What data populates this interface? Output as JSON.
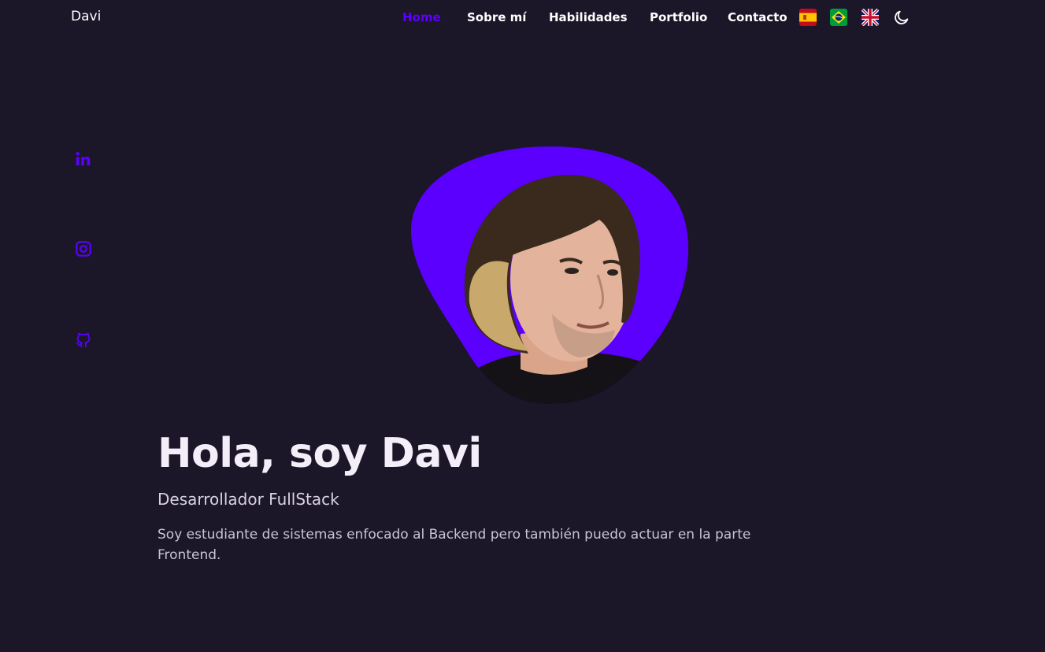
{
  "header": {
    "logo": "Davi",
    "nav": [
      {
        "label": "Home",
        "active": true
      },
      {
        "label": "Sobre mí",
        "active": false
      },
      {
        "label": "Habilidades",
        "active": false
      },
      {
        "label": "Portfolio",
        "active": false
      },
      {
        "label": "Contacto",
        "active": false
      }
    ],
    "languages": [
      "spain-flag-icon",
      "brazil-flag-icon",
      "uk-flag-icon"
    ],
    "theme_icon": "moon-icon"
  },
  "social": [
    "linkedin-icon",
    "instagram-icon",
    "github-icon"
  ],
  "hero": {
    "title": "Hola, soy Davi",
    "subtitle": "Desarrollador FullStack",
    "description": "Soy estudiante de sistemas enfocado al Backend pero también puedo actuar en la parte Frontend."
  },
  "colors": {
    "background": "#1b1628",
    "accent": "#5b00ff",
    "text": "#ffffff"
  }
}
